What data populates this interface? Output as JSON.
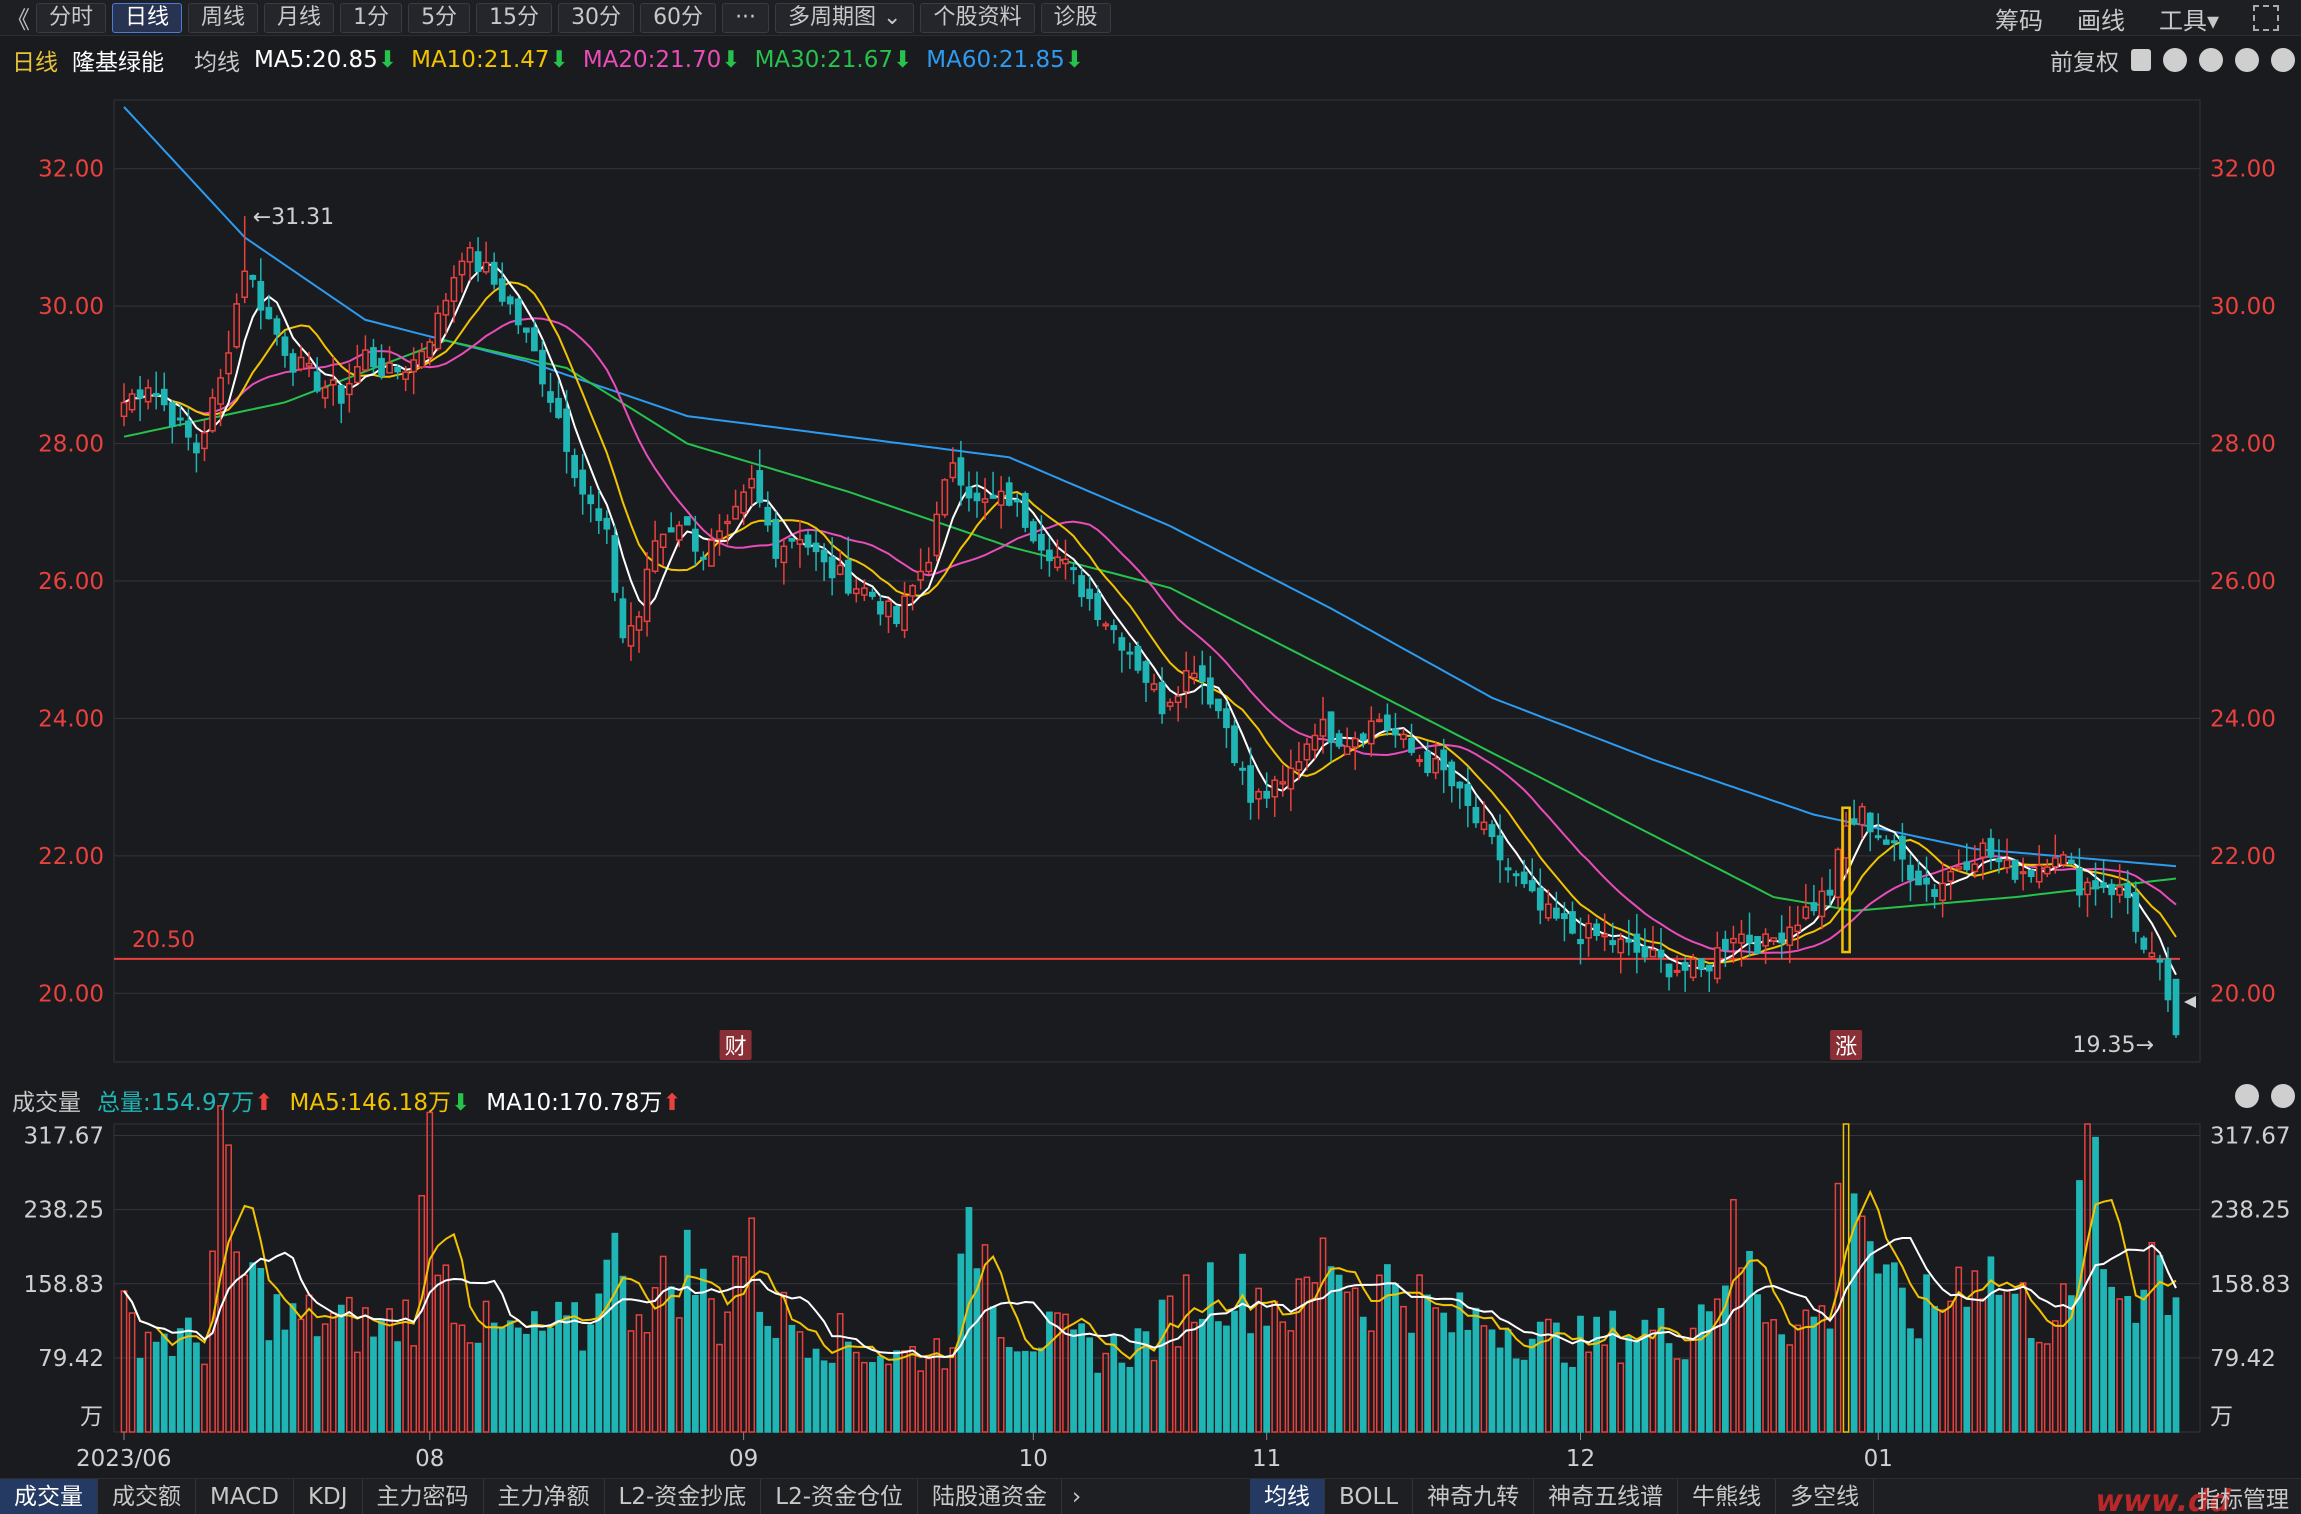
{
  "toolbar": {
    "back": "《",
    "buttons": [
      "分时",
      "日线",
      "周线",
      "月线",
      "1分",
      "5分",
      "15分",
      "30分",
      "60分",
      "···",
      "多周期图 ⌄",
      "个股资料",
      "诊股"
    ],
    "active_index": 1,
    "right": [
      "筹码",
      "画线",
      "工具▾"
    ]
  },
  "info": {
    "period": "日线",
    "stock": "隆基绿能",
    "ma_label": "均线",
    "ma5": "MA5:20.85",
    "ma10": "MA10:21.47",
    "ma20": "MA20:21.70",
    "ma30": "MA30:21.67",
    "ma60": "MA60:21.85",
    "down_arrow": "⬇",
    "right_label": "前复权"
  },
  "vol_info": {
    "label": "成交量",
    "total": "总量:154.97万",
    "ma5": "MA5:146.18万",
    "ma10": "MA10:170.78万",
    "up_arrow": "⬆",
    "down_arrow": "⬇"
  },
  "colors": {
    "up": "#e8413e",
    "down": "#20b5b5",
    "ma5": "#ffffff",
    "ma10": "#f2c300",
    "ma20": "#e84db9",
    "ma30": "#27c24c",
    "ma60": "#2d9bf0",
    "axis_text": "#e8413e"
  },
  "bottom_tabs": {
    "left": [
      "成交量",
      "成交额",
      "MACD",
      "KDJ",
      "主力密码",
      "主力净额",
      "L2-资金抄底",
      "L2-资金仓位",
      "陆股通资金"
    ],
    "left_active": 0,
    "right": [
      "均线",
      "BOLL",
      "神奇九转",
      "神奇五线谱",
      "牛熊线",
      "多空线"
    ],
    "right_active": 0,
    "more": "指标管理",
    "arrow": "›"
  },
  "watermark": "www.dd",
  "chart_data": {
    "type": "candlestick",
    "price_axis": {
      "min": 19.0,
      "max": 33.0,
      "ticks": [
        20.0,
        22.0,
        24.0,
        26.0,
        28.0,
        30.0,
        32.0
      ],
      "tick_labels": [
        "20.00",
        "22.00",
        "24.00",
        "26.00",
        "28.00",
        "30.00",
        "32.00"
      ]
    },
    "volume_axis": {
      "max": 330,
      "ticks": [
        79.42,
        158.83,
        238.25,
        317.67
      ],
      "tick_labels": [
        "79.42",
        "158.83",
        "238.25",
        "317.67"
      ],
      "unit": "万"
    },
    "x_labels": [
      {
        "label": "2023/06",
        "index": 0
      },
      {
        "label": "08",
        "index": 38
      },
      {
        "label": "09",
        "index": 77
      },
      {
        "label": "10",
        "index": 113
      },
      {
        "label": "11",
        "index": 142
      },
      {
        "label": "12",
        "index": 181
      },
      {
        "label": "01",
        "index": 218
      }
    ],
    "annotations": {
      "high": {
        "label": "←31.31",
        "index": 15,
        "value": 31.31
      },
      "low": {
        "label": "19.35→",
        "index": 254,
        "value": 19.35
      },
      "hline": {
        "label": "20.50",
        "value": 20.5
      },
      "markers": [
        {
          "label": "财",
          "index": 76
        },
        {
          "label": "涨",
          "index": 214
        }
      ]
    },
    "anchors": [
      [
        0,
        28.6
      ],
      [
        3,
        28.9
      ],
      [
        6,
        28.4
      ],
      [
        9,
        27.9
      ],
      [
        12,
        28.9
      ],
      [
        15,
        30.6
      ],
      [
        18,
        29.8
      ],
      [
        21,
        29.2
      ],
      [
        24,
        28.9
      ],
      [
        27,
        28.7
      ],
      [
        30,
        29.3
      ],
      [
        33,
        29.0
      ],
      [
        36,
        29.2
      ],
      [
        39,
        29.8
      ],
      [
        42,
        30.8
      ],
      [
        45,
        30.5
      ],
      [
        48,
        30.0
      ],
      [
        51,
        29.3
      ],
      [
        54,
        28.4
      ],
      [
        57,
        27.3
      ],
      [
        60,
        26.6
      ],
      [
        62,
        25.2
      ],
      [
        64,
        25.5
      ],
      [
        66,
        26.6
      ],
      [
        69,
        26.9
      ],
      [
        72,
        26.4
      ],
      [
        75,
        26.7
      ],
      [
        78,
        27.4
      ],
      [
        81,
        26.5
      ],
      [
        84,
        26.7
      ],
      [
        87,
        26.2
      ],
      [
        90,
        26.0
      ],
      [
        93,
        25.8
      ],
      [
        96,
        25.4
      ],
      [
        100,
        26.4
      ],
      [
        103,
        27.8
      ],
      [
        106,
        27.1
      ],
      [
        110,
        27.2
      ],
      [
        114,
        26.6
      ],
      [
        117,
        26.2
      ],
      [
        121,
        25.6
      ],
      [
        125,
        25.0
      ],
      [
        129,
        24.2
      ],
      [
        133,
        24.8
      ],
      [
        137,
        23.9
      ],
      [
        140,
        22.8
      ],
      [
        144,
        23.0
      ],
      [
        148,
        23.9
      ],
      [
        152,
        23.7
      ],
      [
        156,
        24.0
      ],
      [
        160,
        23.5
      ],
      [
        164,
        23.2
      ],
      [
        168,
        22.5
      ],
      [
        172,
        21.8
      ],
      [
        176,
        21.2
      ],
      [
        180,
        20.9
      ],
      [
        184,
        20.8
      ],
      [
        188,
        20.6
      ],
      [
        192,
        20.4
      ],
      [
        196,
        20.3
      ],
      [
        200,
        20.9
      ],
      [
        204,
        20.7
      ],
      [
        208,
        21.1
      ],
      [
        212,
        21.5
      ],
      [
        214,
        22.4
      ],
      [
        216,
        22.6
      ],
      [
        219,
        22.2
      ],
      [
        222,
        21.8
      ],
      [
        225,
        21.5
      ],
      [
        228,
        21.9
      ],
      [
        231,
        22.1
      ],
      [
        234,
        21.8
      ],
      [
        237,
        21.8
      ],
      [
        240,
        22.1
      ],
      [
        243,
        21.6
      ],
      [
        246,
        21.6
      ],
      [
        249,
        21.4
      ],
      [
        251,
        20.6
      ],
      [
        253,
        20.3
      ],
      [
        255,
        19.6
      ]
    ],
    "volume_anchors": [
      [
        0,
        120
      ],
      [
        5,
        100
      ],
      [
        10,
        95
      ],
      [
        12,
        300
      ],
      [
        14,
        180
      ],
      [
        16,
        160
      ],
      [
        20,
        115
      ],
      [
        24,
        120
      ],
      [
        28,
        115
      ],
      [
        32,
        110
      ],
      [
        36,
        130
      ],
      [
        38,
        300
      ],
      [
        40,
        165
      ],
      [
        44,
        110
      ],
      [
        50,
        100
      ],
      [
        54,
        110
      ],
      [
        58,
        105
      ],
      [
        60,
        240
      ],
      [
        62,
        140
      ],
      [
        66,
        145
      ],
      [
        70,
        180
      ],
      [
        74,
        120
      ],
      [
        77,
        210
      ],
      [
        80,
        130
      ],
      [
        84,
        115
      ],
      [
        90,
        95
      ],
      [
        96,
        80
      ],
      [
        102,
        90
      ],
      [
        106,
        220
      ],
      [
        110,
        110
      ],
      [
        116,
        100
      ],
      [
        122,
        85
      ],
      [
        128,
        100
      ],
      [
        132,
        140
      ],
      [
        136,
        160
      ],
      [
        140,
        150
      ],
      [
        146,
        130
      ],
      [
        150,
        200
      ],
      [
        154,
        140
      ],
      [
        158,
        165
      ],
      [
        164,
        115
      ],
      [
        170,
        120
      ],
      [
        176,
        100
      ],
      [
        182,
        95
      ],
      [
        188,
        110
      ],
      [
        194,
        105
      ],
      [
        198,
        165
      ],
      [
        200,
        200
      ],
      [
        204,
        140
      ],
      [
        208,
        115
      ],
      [
        212,
        130
      ],
      [
        214,
        320
      ],
      [
        216,
        240
      ],
      [
        219,
        150
      ],
      [
        222,
        120
      ],
      [
        226,
        140
      ],
      [
        230,
        190
      ],
      [
        234,
        150
      ],
      [
        238,
        120
      ],
      [
        242,
        130
      ],
      [
        244,
        330
      ],
      [
        246,
        160
      ],
      [
        250,
        150
      ],
      [
        252,
        200
      ],
      [
        254,
        160
      ],
      [
        255,
        155
      ]
    ],
    "ma60_anchors": [
      [
        0,
        32.9
      ],
      [
        15,
        31.0
      ],
      [
        30,
        29.8
      ],
      [
        50,
        29.2
      ],
      [
        70,
        28.4
      ],
      [
        90,
        28.1
      ],
      [
        110,
        27.8
      ],
      [
        130,
        26.8
      ],
      [
        150,
        25.6
      ],
      [
        170,
        24.3
      ],
      [
        190,
        23.4
      ],
      [
        210,
        22.6
      ],
      [
        230,
        22.1
      ],
      [
        255,
        21.85
      ]
    ],
    "ma30_anchors": [
      [
        0,
        28.1
      ],
      [
        20,
        28.6
      ],
      [
        40,
        29.5
      ],
      [
        55,
        29.1
      ],
      [
        70,
        28.0
      ],
      [
        90,
        27.3
      ],
      [
        110,
        26.5
      ],
      [
        130,
        25.9
      ],
      [
        150,
        24.7
      ],
      [
        170,
        23.5
      ],
      [
        190,
        22.3
      ],
      [
        205,
        21.4
      ],
      [
        215,
        21.2
      ],
      [
        235,
        21.4
      ],
      [
        255,
        21.67
      ]
    ]
  }
}
